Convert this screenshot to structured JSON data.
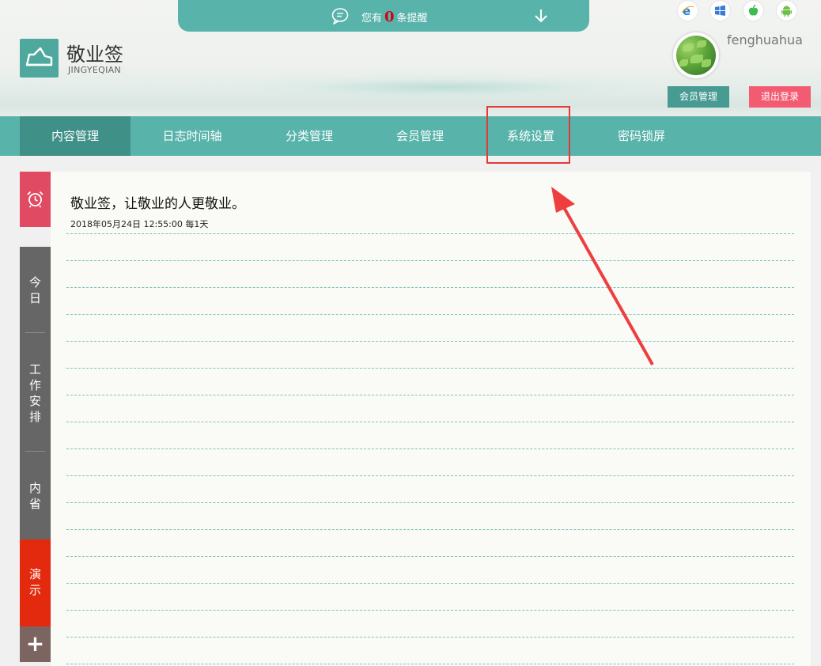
{
  "header": {
    "notification": {
      "prefix": "您有",
      "count": "0",
      "suffix": "条提醒",
      "icon": "chat-bubble-icon",
      "expand_icon": "arrow-down-icon"
    },
    "brand": {
      "title": "敬业签",
      "subtitle": "JINGYEQIAN",
      "logo_icon": "shoe-logo-icon"
    },
    "platforms": [
      "ie-icon",
      "windows-icon",
      "apple-icon",
      "android-icon"
    ],
    "user": {
      "name": "fenghuahua",
      "member_button": "会员管理",
      "logout_button": "退出登录"
    }
  },
  "nav": {
    "items": [
      {
        "label": "内容管理",
        "active": true
      },
      {
        "label": "日志时间轴",
        "active": false
      },
      {
        "label": "分类管理",
        "active": false
      },
      {
        "label": "会员管理",
        "active": false
      },
      {
        "label": "系统设置",
        "active": false
      },
      {
        "label": "密码锁屏",
        "active": false
      }
    ]
  },
  "sidebar": {
    "alarm_icon": "alarm-clock-icon",
    "tabs": [
      "今日",
      "工作安排",
      "内省"
    ],
    "demo_tab": "演示",
    "add_label": "+"
  },
  "note": {
    "text": "敬业签，让敬业的人更敬业。",
    "meta": "2018年05月24日 12:55:00 每1天"
  },
  "annotation": {
    "highlight_color": "#e53935",
    "target": "系统设置"
  },
  "colors": {
    "teal": "#58b3aa",
    "teal_dark": "#3f9087",
    "alarm_red": "#e04a62",
    "demo_red": "#e42a0e",
    "logout_pink": "#f35b73"
  }
}
